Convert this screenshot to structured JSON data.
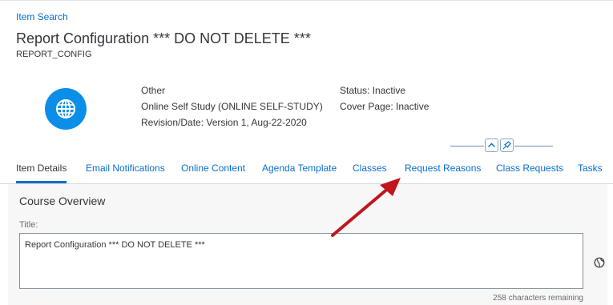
{
  "breadcrumb": "Item Search",
  "header": {
    "title": "Report Configuration *** DO NOT DELETE ***",
    "subtitle": "REPORT_CONFIG",
    "avatar_icon": "globe-icon",
    "type": "Other",
    "delivery": "Online Self Study (ONLINE SELF-STUDY)",
    "revision": "Revision/Date: Version 1, Aug-22-2020",
    "status": "Status: Inactive",
    "cover_page": "Cover Page: Inactive",
    "collapse_icon": "chevron-up-icon",
    "pin_icon": "pin-icon"
  },
  "tabs": [
    {
      "label": "Item Details",
      "active": true
    },
    {
      "label": "Email Notifications"
    },
    {
      "label": "Online Content"
    },
    {
      "label": "Agenda Template"
    },
    {
      "label": "Classes"
    },
    {
      "label": "Request Reasons"
    },
    {
      "label": "Class Requests"
    },
    {
      "label": "Tasks"
    }
  ],
  "section": {
    "title": "Course Overview",
    "field_label": "Title:",
    "field_value": "Report Configuration *** DO NOT DELETE ***",
    "chars_remaining": "258 characters remaining",
    "translate_icon": "globe-icon"
  },
  "colors": {
    "link": "#0a6ed1",
    "avatar_bg": "#0a8ee8",
    "annotation_arrow": "#c0161c"
  }
}
